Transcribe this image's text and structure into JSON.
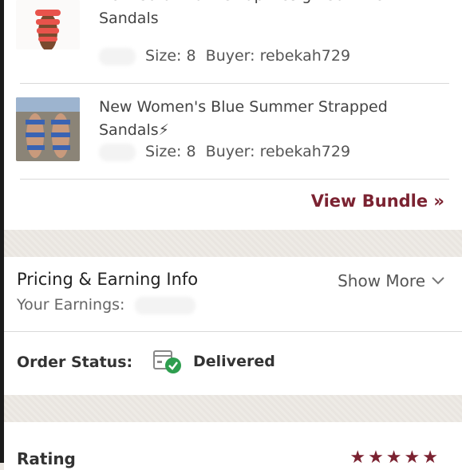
{
  "items": [
    {
      "title_lines": [
        "New Coral Multi Strap Design Summer",
        "Sandals"
      ],
      "size": "Size: 8",
      "buyer": "Buyer: rebekah729"
    },
    {
      "title_lines": [
        "New Women's Blue Summer Strapped",
        "Sandals⚡"
      ],
      "size": "Size: 8",
      "buyer": "Buyer: rebekah729"
    }
  ],
  "bundle": {
    "link_label": "View Bundle »"
  },
  "pricing": {
    "title": "Pricing & Earning Info",
    "show_more_label": "Show More",
    "earnings_label": "Your Earnings:"
  },
  "order": {
    "status_label": "Order Status:",
    "status_value": "Delivered"
  },
  "rating": {
    "title": "Rating",
    "stars": 5
  },
  "colors": {
    "accent": "#7b2231",
    "delivered_check": "#2e9e4f"
  }
}
